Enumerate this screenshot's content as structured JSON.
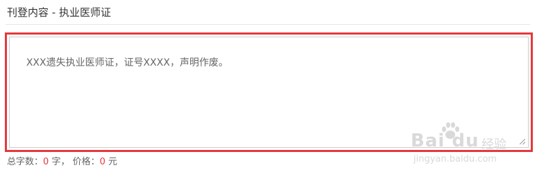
{
  "header": {
    "title": "刊登内容 - 执业医师证"
  },
  "editor": {
    "content": "XXX遗失执业医师证，证号XXXX，声明作废。"
  },
  "footer": {
    "word_count_label": "总字数：",
    "word_count_value": "0",
    "word_unit": "字，",
    "price_label": "价格：",
    "price_value": "0",
    "price_unit": "元"
  },
  "watermark": {
    "brand": "Bai du",
    "brand_cn": "经验",
    "url": "jingyan.baidu.com"
  },
  "colors": {
    "highlight": "#e5383c",
    "number": "#e5383c"
  }
}
